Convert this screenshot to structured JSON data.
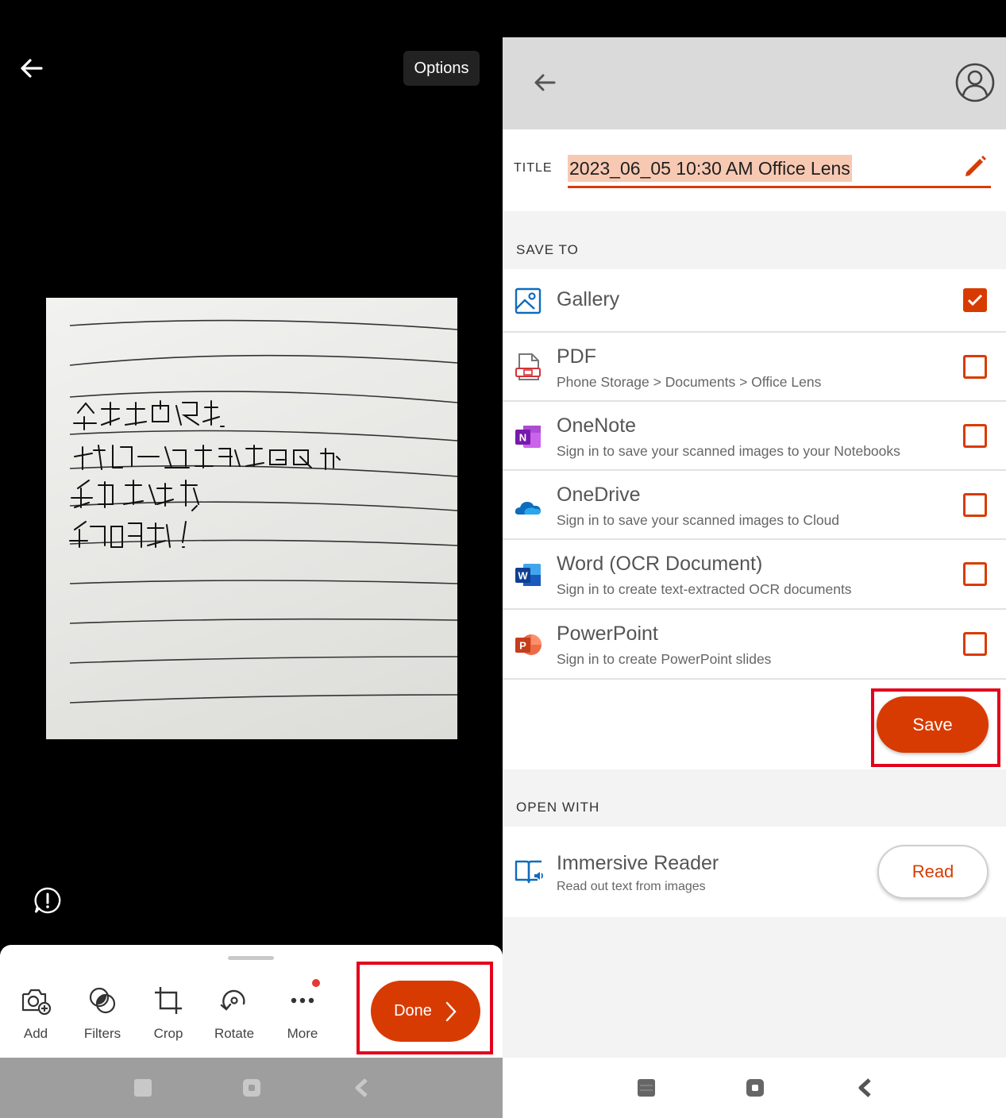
{
  "left": {
    "options_label": "Options",
    "toolbar": [
      {
        "label": "Add",
        "icon": "add-camera-icon"
      },
      {
        "label": "Filters",
        "icon": "filters-icon"
      },
      {
        "label": "Crop",
        "icon": "crop-icon"
      },
      {
        "label": "Rotate",
        "icon": "rotate-icon"
      },
      {
        "label": "More",
        "icon": "more-icon"
      }
    ],
    "done_label": "Done"
  },
  "right": {
    "title_label": "TITLE",
    "title_value": "2023_06_05 10:30 AM Office Lens",
    "save_to_header": "SAVE TO",
    "destinations": [
      {
        "name": "Gallery",
        "subtitle": "",
        "checked": true,
        "icon": "gallery-icon"
      },
      {
        "name": "PDF",
        "subtitle": "Phone Storage > Documents > Office Lens",
        "checked": false,
        "icon": "pdf-icon"
      },
      {
        "name": "OneNote",
        "subtitle": "Sign in to save your scanned images to your Notebooks",
        "checked": false,
        "icon": "onenote-icon"
      },
      {
        "name": "OneDrive",
        "subtitle": "Sign in to save your scanned images to Cloud",
        "checked": false,
        "icon": "onedrive-icon"
      },
      {
        "name": "Word (OCR Document)",
        "subtitle": "Sign in to create text-extracted OCR documents",
        "checked": false,
        "icon": "word-icon"
      },
      {
        "name": "PowerPoint",
        "subtitle": "Sign in to create PowerPoint slides",
        "checked": false,
        "icon": "powerpoint-icon"
      }
    ],
    "save_label": "Save",
    "open_with_header": "OPEN WITH",
    "reader": {
      "name": "Immersive Reader",
      "subtitle": "Read out text from images",
      "button": "Read"
    }
  },
  "colors": {
    "accent": "#d83b01",
    "highlight": "#e3001b",
    "title_highlight": "#f7c9b3"
  }
}
